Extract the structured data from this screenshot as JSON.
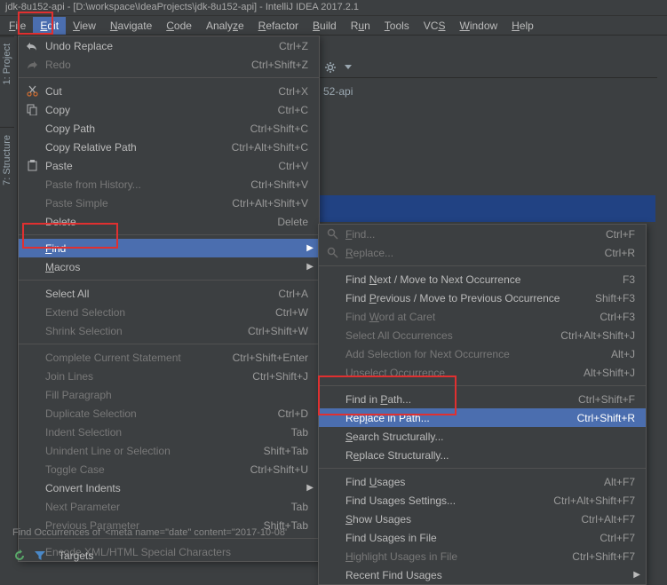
{
  "window": {
    "title": "jdk-8u152-api - [D:\\workspace\\IdeaProjects\\jdk-8u152-api] - IntelliJ IDEA 2017.2.1"
  },
  "menubar": {
    "items": [
      "File",
      "Edit",
      "View",
      "Navigate",
      "Code",
      "Analyze",
      "Refactor",
      "Build",
      "Run",
      "Tools",
      "VCS",
      "Window",
      "Help"
    ]
  },
  "sidebar": {
    "project_tab": "1: Project",
    "structure_tab": "7: Structure"
  },
  "breadcrumb": "52-api",
  "edit_menu": {
    "undo": "Undo Replace",
    "undo_sc": "Ctrl+Z",
    "redo": "Redo",
    "redo_sc": "Ctrl+Shift+Z",
    "cut": "Cut",
    "cut_sc": "Ctrl+X",
    "copy": "Copy",
    "copy_sc": "Ctrl+C",
    "copy_path": "Copy Path",
    "copy_path_sc": "Ctrl+Shift+C",
    "copy_rel": "Copy Relative Path",
    "copy_rel_sc": "Ctrl+Alt+Shift+C",
    "paste": "Paste",
    "paste_sc": "Ctrl+V",
    "paste_hist": "Paste from History...",
    "paste_hist_sc": "Ctrl+Shift+V",
    "paste_simple": "Paste Simple",
    "paste_simple_sc": "Ctrl+Alt+Shift+V",
    "delete": "Delete",
    "delete_sc": "Delete",
    "find": "Find",
    "macros": "Macros",
    "select_all": "Select All",
    "select_all_sc": "Ctrl+A",
    "extend_sel": "Extend Selection",
    "extend_sel_sc": "Ctrl+W",
    "shrink_sel": "Shrink Selection",
    "shrink_sel_sc": "Ctrl+Shift+W",
    "complete_stmt": "Complete Current Statement",
    "complete_stmt_sc": "Ctrl+Shift+Enter",
    "join_lines": "Join Lines",
    "join_lines_sc": "Ctrl+Shift+J",
    "fill_para": "Fill Paragraph",
    "dup_sel": "Duplicate Selection",
    "dup_sel_sc": "Ctrl+D",
    "indent": "Indent Selection",
    "indent_sc": "Tab",
    "unindent": "Unindent Line or Selection",
    "unindent_sc": "Shift+Tab",
    "toggle_case": "Toggle Case",
    "toggle_case_sc": "Ctrl+Shift+U",
    "convert_indents": "Convert Indents",
    "next_param": "Next Parameter",
    "next_param_sc": "Tab",
    "prev_param": "Previous Parameter",
    "prev_param_sc": "Shift+Tab",
    "encode": "Encode XML/HTML Special Characters"
  },
  "find_menu": {
    "find": "Find...",
    "find_sc": "Ctrl+F",
    "replace": "Replace...",
    "replace_sc": "Ctrl+R",
    "find_next": "Find Next / Move to Next Occurrence",
    "find_next_sc": "F3",
    "find_prev": "Find Previous / Move to Previous Occurrence",
    "find_prev_sc": "Shift+F3",
    "find_word": "Find Word at Caret",
    "find_word_sc": "Ctrl+F3",
    "select_all_occ": "Select All Occurrences",
    "select_all_occ_sc": "Ctrl+Alt+Shift+J",
    "add_sel": "Add Selection for Next Occurrence",
    "add_sel_sc": "Alt+J",
    "unselect": "Unselect Occurrence",
    "unselect_sc": "Alt+Shift+J",
    "find_in_path": "Find in Path...",
    "find_in_path_sc": "Ctrl+Shift+F",
    "replace_in_path": "Replace in Path...",
    "replace_in_path_sc": "Ctrl+Shift+R",
    "search_struct": "Search Structurally...",
    "replace_struct": "Replace Structurally...",
    "find_usages": "Find Usages",
    "find_usages_sc": "Alt+F7",
    "find_usages_set": "Find Usages Settings...",
    "find_usages_set_sc": "Ctrl+Alt+Shift+F7",
    "show_usages": "Show Usages",
    "show_usages_sc": "Ctrl+Alt+F7",
    "find_usages_file": "Find Usages in File",
    "find_usages_file_sc": "Ctrl+F7",
    "highlight": "Highlight Usages in File",
    "highlight_sc": "Ctrl+Shift+F7",
    "recent": "Recent Find Usages"
  },
  "status": "Find Occurrences of '<meta name=\"date\" content=\"2017-10-08'",
  "bottom": {
    "targets": "Targets"
  }
}
